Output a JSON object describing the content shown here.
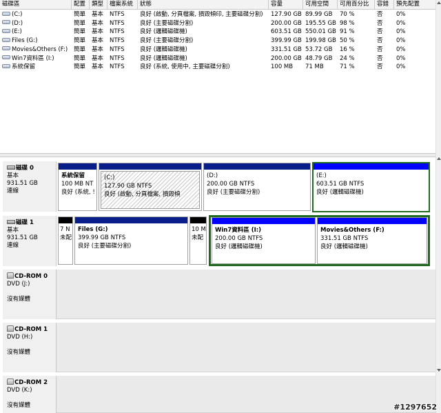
{
  "columns": [
    "磁碟區",
    "配置",
    "類型",
    "檔案系統",
    "狀態",
    "容量",
    "可用空間",
    "可用百分比",
    "容錯",
    "預先配置"
  ],
  "volumes": [
    {
      "name": "(C:)",
      "layout": "簡單",
      "type": "基本",
      "fs": "NTFS",
      "status": "良好 (啟動, 分頁檔案, 損毀傾印, 主要磁碟分割)",
      "capacity": "127.90 GB",
      "free": "89.99 GB",
      "pct": "70 %",
      "fault": "否",
      "overhead": "0%"
    },
    {
      "name": "(D:)",
      "layout": "簡單",
      "type": "基本",
      "fs": "NTFS",
      "status": "良好 (主要磁碟分割)",
      "capacity": "200.00 GB",
      "free": "195.55 GB",
      "pct": "98 %",
      "fault": "否",
      "overhead": "0%"
    },
    {
      "name": "(E:)",
      "layout": "簡單",
      "type": "基本",
      "fs": "NTFS",
      "status": "良好 (邏輯磁碟機)",
      "capacity": "603.51 GB",
      "free": "550.01 GB",
      "pct": "91 %",
      "fault": "否",
      "overhead": "0%"
    },
    {
      "name": "Files (G:)",
      "layout": "簡單",
      "type": "基本",
      "fs": "NTFS",
      "status": "良好 (主要磁碟分割)",
      "capacity": "399.99 GB",
      "free": "199.98 GB",
      "pct": "50 %",
      "fault": "否",
      "overhead": "0%"
    },
    {
      "name": "Movies&Others (F:)",
      "layout": "簡單",
      "type": "基本",
      "fs": "NTFS",
      "status": "良好 (邏輯磁碟機)",
      "capacity": "331.51 GB",
      "free": "53.72 GB",
      "pct": "16 %",
      "fault": "否",
      "overhead": "0%"
    },
    {
      "name": "Win7資料區 (I:)",
      "layout": "簡單",
      "type": "基本",
      "fs": "NTFS",
      "status": "良好 (邏輯磁碟機)",
      "capacity": "200.00 GB",
      "free": "48.79 GB",
      "pct": "24 %",
      "fault": "否",
      "overhead": "0%"
    },
    {
      "name": "系統保留",
      "layout": "簡單",
      "type": "基本",
      "fs": "NTFS",
      "status": "良好 (系統, 使用中, 主要磁碟分割)",
      "capacity": "100 MB",
      "free": "71 MB",
      "pct": "71 %",
      "fault": "否",
      "overhead": "0%"
    }
  ],
  "disks": [
    {
      "name": "磁碟 0",
      "type": "基本",
      "size": "931.51 GB",
      "status": "連線",
      "partitions": [
        {
          "title": "系統保留",
          "size": "100 MB NT",
          "status": "良好 (系統, !"
        },
        {
          "title": "(C:)",
          "size": "127.90 GB NTFS",
          "status": "良好 (啟動, 分頁檔案, 損毀傾"
        },
        {
          "title": "(D:)",
          "size": "200.00 GB NTFS",
          "status": "良好 (主要磁碟分割)"
        },
        {
          "title": "(E:)",
          "size": "603.51 GB NTFS",
          "status": "良好 (邏輯磁碟機)"
        }
      ]
    },
    {
      "name": "磁碟 1",
      "type": "基本",
      "size": "931.51 GB",
      "status": "連線",
      "partitions": [
        {
          "title": "",
          "size": "7 N",
          "status": "未配"
        },
        {
          "title": "Files  (G:)",
          "size": "399.99 GB NTFS",
          "status": "良好 (主要磁碟分割)"
        },
        {
          "title": "",
          "size": "10 M",
          "status": "未配"
        },
        {
          "title": "Win7資料區  (I:)",
          "size": "200.00 GB NTFS",
          "status": "良好 (邏輯磁碟機)"
        },
        {
          "title": "Movies&Others  (F:)",
          "size": "331.51 GB NTFS",
          "status": "良好 (邏輯磁碟機)"
        }
      ]
    }
  ],
  "cdroms": [
    {
      "name": "CD-ROM 0",
      "drive": "DVD (J:)",
      "media": "沒有媒體"
    },
    {
      "name": "CD-ROM 1",
      "drive": "DVD (H:)",
      "media": "沒有媒體"
    },
    {
      "name": "CD-ROM 2",
      "drive": "DVD (K:)",
      "media": "沒有媒體"
    }
  ],
  "watermark": "#1297652",
  "icons": {
    "volume": "volume-disk-icon",
    "disk": "hard-disk-icon",
    "cdrom": "cdrom-icon"
  },
  "colors": {
    "primary_bar": "#0a1e8a",
    "logical_bar": "#0000ff",
    "unallocated_bar": "#000000",
    "selection": "#1e6b1e"
  }
}
